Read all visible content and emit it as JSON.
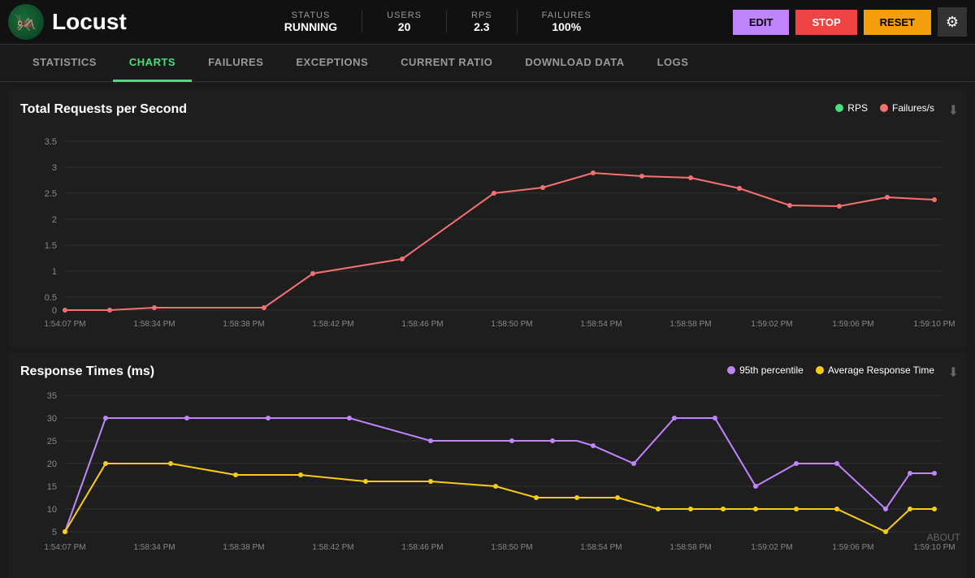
{
  "header": {
    "logo_text": "Locust",
    "status_label": "STATUS",
    "status_value": "RUNNING",
    "users_label": "USERS",
    "users_value": "20",
    "rps_label": "RPS",
    "rps_value": "2.3",
    "failures_label": "FAILURES",
    "failures_value": "100%",
    "edit_label": "EDIT",
    "stop_label": "STOP",
    "reset_label": "RESET"
  },
  "nav": {
    "items": [
      {
        "id": "statistics",
        "label": "STATISTICS",
        "active": false
      },
      {
        "id": "charts",
        "label": "CHARTS",
        "active": true
      },
      {
        "id": "failures",
        "label": "FAILURES",
        "active": false
      },
      {
        "id": "exceptions",
        "label": "EXCEPTIONS",
        "active": false
      },
      {
        "id": "current-ratio",
        "label": "CURRENT RATIO",
        "active": false
      },
      {
        "id": "download-data",
        "label": "DOWNLOAD DATA",
        "active": false
      },
      {
        "id": "logs",
        "label": "LOGS",
        "active": false
      }
    ]
  },
  "charts": {
    "rps_chart": {
      "title": "Total Requests per Second",
      "legend": [
        {
          "label": "RPS",
          "color": "#4ade80"
        },
        {
          "label": "Failures/s",
          "color": "#f87171"
        }
      ],
      "y_labels": [
        "3.5",
        "3",
        "2.5",
        "2",
        "1.5",
        "1",
        "0.5",
        "0"
      ],
      "x_labels": [
        "1:54:07 PM",
        "1:58:34 PM",
        "1:58:38 PM",
        "1:58:42 PM",
        "1:58:46 PM",
        "1:58:50 PM",
        "1:58:54 PM",
        "1:58:58 PM",
        "1:59:02 PM",
        "1:59:06 PM",
        "1:59:10 PM"
      ]
    },
    "response_chart": {
      "title": "Response Times (ms)",
      "legend": [
        {
          "label": "95th percentile",
          "color": "#c084fc"
        },
        {
          "label": "Average Response Time",
          "color": "#facc15"
        }
      ],
      "y_labels": [
        "35",
        "30",
        "25",
        "20",
        "15",
        "10",
        "5"
      ],
      "x_labels": [
        "1:54:07 PM",
        "1:58:34 PM",
        "1:58:38 PM",
        "1:58:42 PM",
        "1:58:46 PM",
        "1:58:50 PM",
        "1:58:54 PM",
        "1:58:58 PM",
        "1:59:02 PM",
        "1:59:06 PM",
        "1:59:10 PM"
      ]
    }
  },
  "about_label": "ABOUT"
}
